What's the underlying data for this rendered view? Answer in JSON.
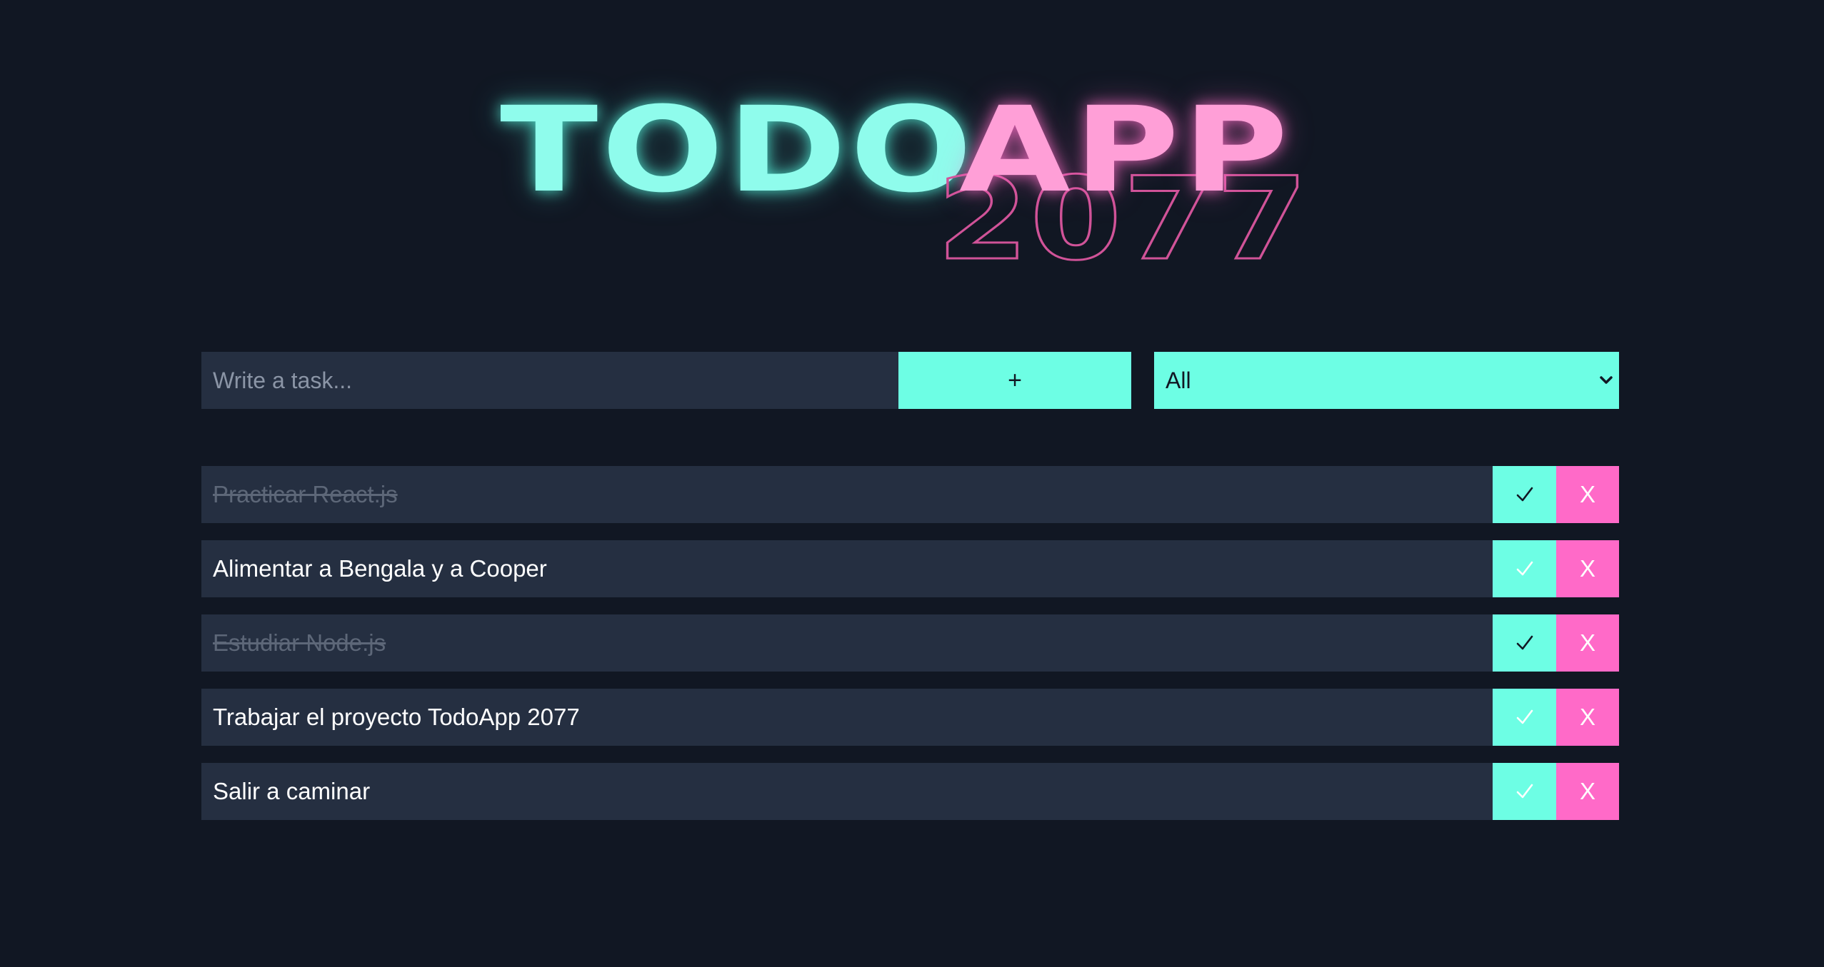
{
  "logo": {
    "todo": "TODO",
    "app": "APP",
    "year": "2077"
  },
  "form": {
    "input_placeholder": "Write a task...",
    "input_value": "",
    "add_label": "+",
    "filter": {
      "selected": "All",
      "icon": "chevron-down-icon"
    }
  },
  "tasks": [
    {
      "text": "Practicar React.js",
      "completed": true,
      "complete_icon": "✓",
      "delete_label": "X"
    },
    {
      "text": "Alimentar a Bengala y a Cooper",
      "completed": false,
      "complete_icon": "✓",
      "delete_label": "X"
    },
    {
      "text": "Estudiar Node.js",
      "completed": true,
      "complete_icon": "✓",
      "delete_label": "X"
    },
    {
      "text": "Trabajar el proyecto TodoApp 2077",
      "completed": false,
      "complete_icon": "✓",
      "delete_label": "X"
    },
    {
      "text": "Salir a caminar",
      "completed": false,
      "complete_icon": "✓",
      "delete_label": "X"
    }
  ],
  "colors": {
    "background": "#111723",
    "panel": "#252f41",
    "accent_cyan": "#6dfee4",
    "accent_pink": "#ff6ac8",
    "check_done": "#111723",
    "check_pending": "#ffffff"
  }
}
